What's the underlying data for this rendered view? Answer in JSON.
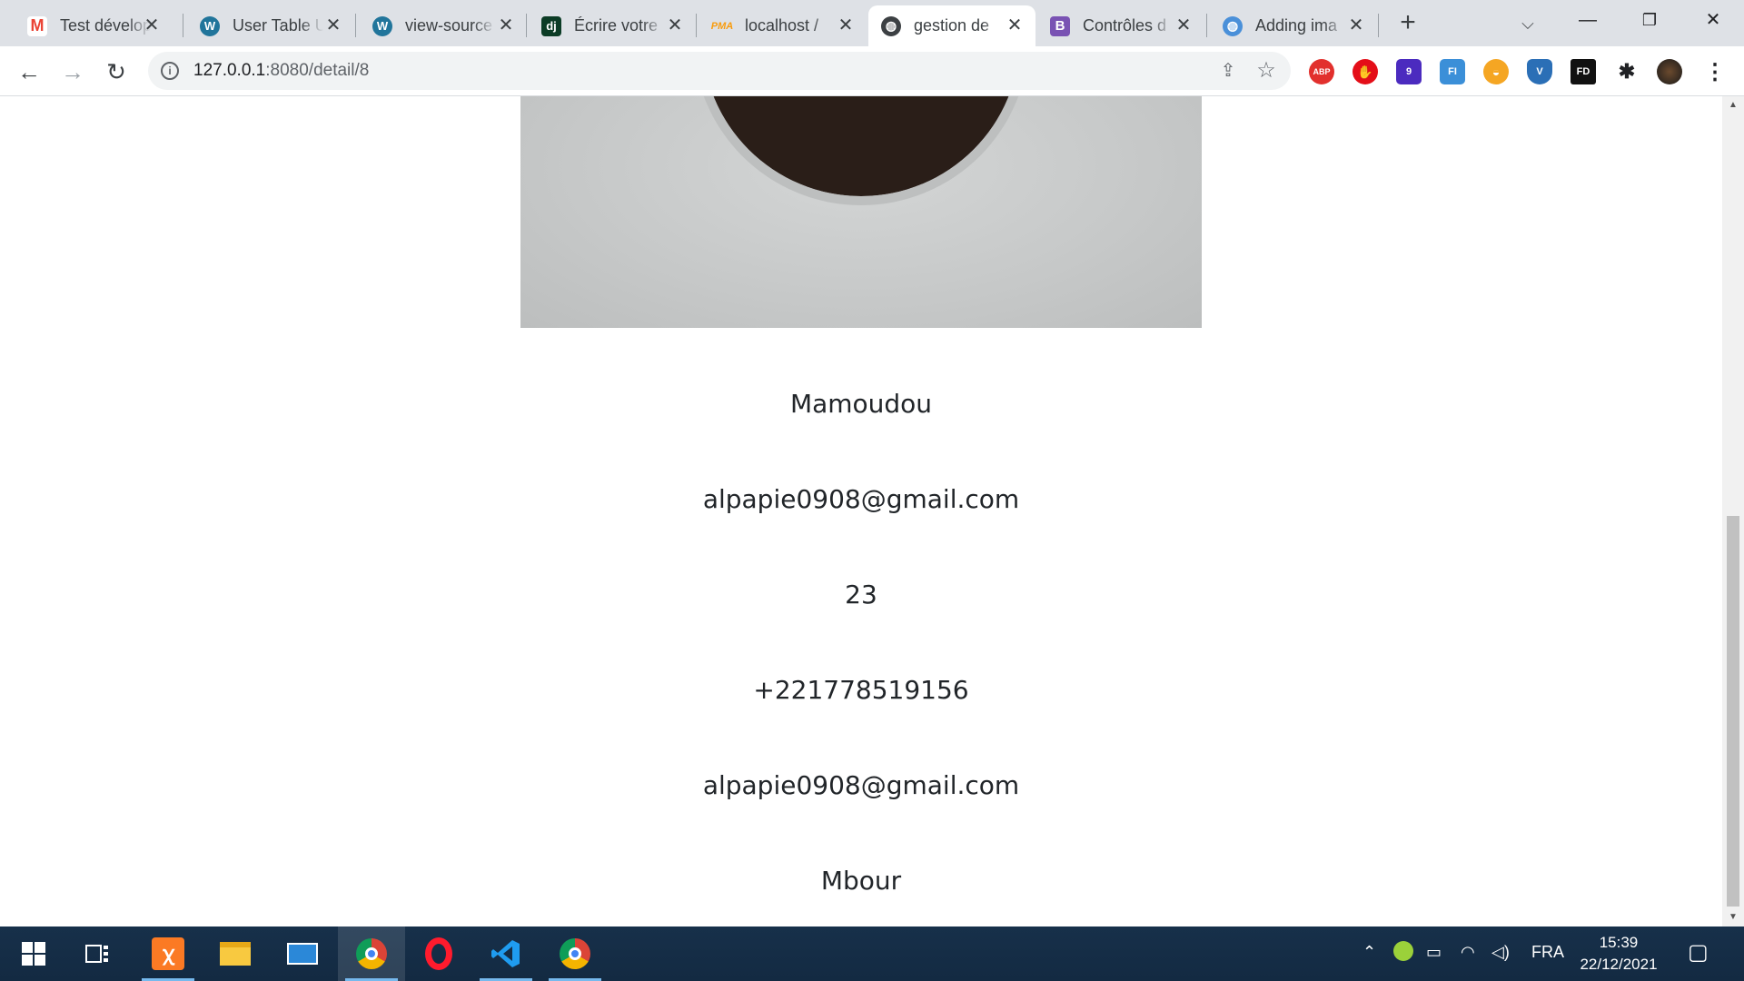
{
  "browser": {
    "tabs": [
      {
        "title": "Test dévelop",
        "icon": "gmail-icon"
      },
      {
        "title": "User Table U",
        "icon": "wordpress-icon"
      },
      {
        "title": "view-source",
        "icon": "wordpress-icon"
      },
      {
        "title": "Écrire votre",
        "icon": "django-icon"
      },
      {
        "title": "localhost /",
        "icon": "phpmyadmin-icon"
      },
      {
        "title": "gestion de",
        "icon": "globe-icon",
        "active": true
      },
      {
        "title": "Contrôles d",
        "icon": "bootstrap-icon"
      },
      {
        "title": "Adding ima",
        "icon": "globe-icon"
      }
    ],
    "url_host": "127.0.0.1",
    "url_path": ":8080/detail/8"
  },
  "profile": {
    "name": "Mamoudou",
    "email": "alpapie0908@gmail.com",
    "age": "23",
    "phone": "+221778519156",
    "email_secondary": "alpapie0908@gmail.com",
    "city": "Mbour"
  },
  "taskbar": {
    "language": "FRA",
    "time": "15:39",
    "date": "22/12/2021"
  },
  "colors": {
    "tabstrip": "#dee1e6",
    "taskbar": "#132a42",
    "text": "#212529"
  }
}
